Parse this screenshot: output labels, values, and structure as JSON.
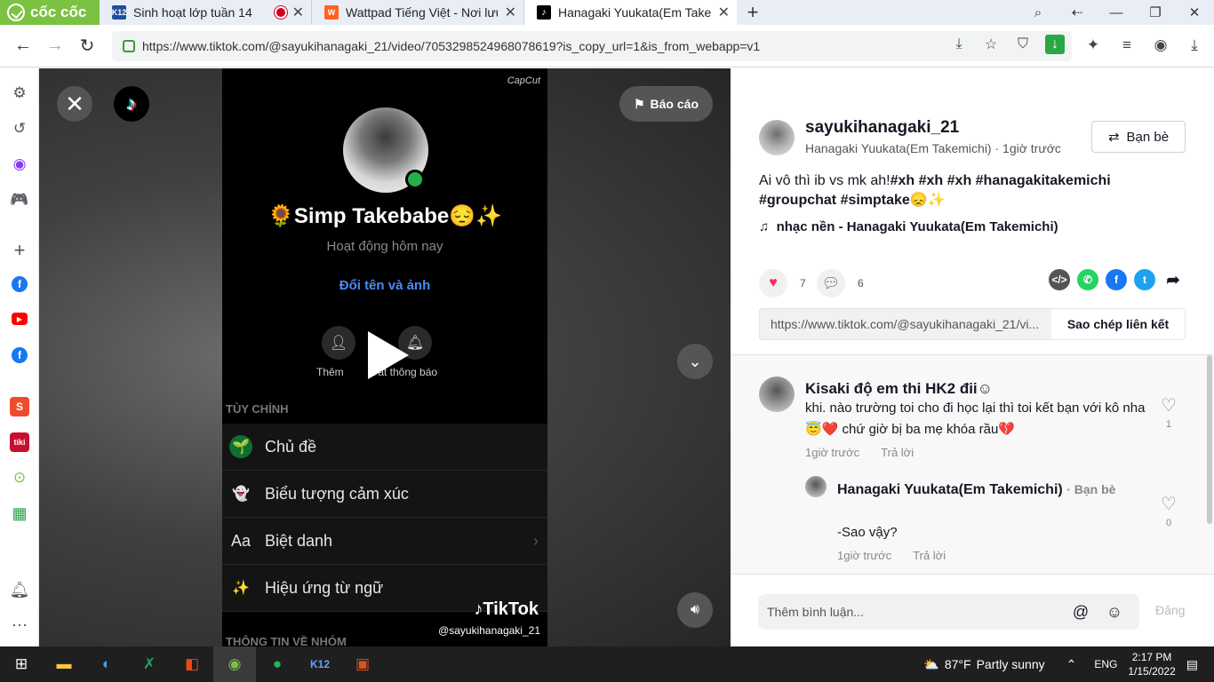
{
  "browser": {
    "brand": "cốc cốc",
    "tabs": [
      {
        "title": "Sinh hoạt lớp tuần 14",
        "favicon": "K12"
      },
      {
        "title": "Wattpad Tiếng Việt - Nơi lưu",
        "favicon": "W"
      },
      {
        "title": "Hanagaki Yuukata(Em Takem",
        "favicon": "tiktok"
      }
    ],
    "url": "https://www.tiktok.com/@sayukihanagaki_21/video/7053298524968078619?is_copy_url=1&is_from_webapp=v1"
  },
  "video": {
    "report_label": "Báo cáo",
    "capcut": "CapCut",
    "group_name": "🌻Simp Takebabe😔✨",
    "activity": "Hoạt động hôm nay",
    "rename": "Đổi tên và ảnh",
    "add_label": "Thêm",
    "notify_label": "Tắt thông báo",
    "section": "TÙY CHỈNH",
    "menu": [
      {
        "icon": "🌱",
        "label": "Chủ đề"
      },
      {
        "icon": "👻",
        "label": "Biểu tượng cảm xúc"
      },
      {
        "icon": "Aa",
        "label": "Biệt danh"
      },
      {
        "icon": "✨",
        "label": "Hiệu ứng từ ngữ"
      }
    ],
    "section2": "THÔNG TIN VỀ NHÓM",
    "watermark": "TikTok",
    "handle": "@sayukihanagaki_21"
  },
  "post": {
    "author": "sayukihanagaki_21",
    "subtitle": "Hanagaki Yuukata(Em Takemichi) · 1giờ trước",
    "friend_label": "Bạn bè",
    "caption_text": "Ai vô thì ib vs mk ah!",
    "caption_tags": "#xh #xh #xh #hanagakitakemichi #groupchat #simptake😞✨",
    "music": "nhạc nền - Hanagaki Yuukata(Em Takemichi)",
    "likes": "7",
    "comments": "6",
    "link": "https://www.tiktok.com/@sayukihanagaki_21/vi...",
    "copy_label": "Sao chép liên kết"
  },
  "comments": [
    {
      "name": "Kisaki độ em thi HK2 đii☺",
      "text": "khi. nào trường toi cho đi học lại thì toi kết bạn với kô nha😇❤️ chứ giờ bị ba mẹ khóa rầu💔",
      "time": "1giờ trước",
      "reply": "Trả lời",
      "likes": "1"
    },
    {
      "name": "Hanagaki Yuukata(Em Takemichi)",
      "badge": "· Bạn bè",
      "text": "-Sao vậy?",
      "time": "1giờ trước",
      "reply": "Trả lời",
      "likes": "0"
    }
  ],
  "composer": {
    "placeholder": "Thêm bình luận...",
    "post_label": "Đăng"
  },
  "taskbar": {
    "temp": "87°F",
    "weather": "Partly sunny",
    "lang": "ENG",
    "time": "2:17 PM",
    "date": "1/15/2022"
  }
}
